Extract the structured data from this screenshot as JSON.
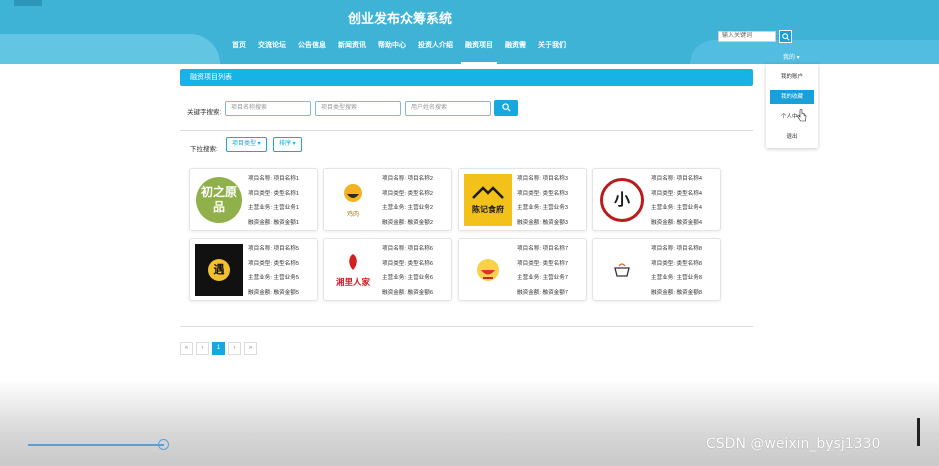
{
  "header": {
    "title": "创业发布众筹系统",
    "nav": [
      "首页",
      "交流论坛",
      "公告信息",
      "新闻资讯",
      "帮助中心",
      "投资人介绍",
      "融资项目",
      "融资需",
      "关于我们"
    ],
    "active_nav_index": 6,
    "search_placeholder": "输入关键词",
    "user_label": "我的 ▾"
  },
  "dropdown": {
    "items": [
      "我的账户",
      "我的收藏",
      "个人中心",
      "退出"
    ],
    "active_index": 1
  },
  "main": {
    "list_title": "融资项目列表",
    "keyword_label": "关键字搜索:",
    "inputs": [
      "项目名称搜索",
      "项目类型搜索",
      "用户姓名搜索"
    ],
    "search_icon": "search-icon",
    "dropdown_label": "下拉搜索:",
    "dropdown_buttons": [
      "项目类型 ▾",
      "排序 ▾"
    ]
  },
  "cards": [
    {
      "name": "项目名称: 项目名称1",
      "type": "项目类型: 类型名称1",
      "biz": "主营业务: 主营业务1",
      "amount": "融资金额: 融资金额1",
      "logo_text": "初之原品"
    },
    {
      "name": "项目名称: 项目名称2",
      "type": "项目类型: 类型名称2",
      "biz": "主营业务: 主营业务2",
      "amount": "融资金额: 融资金额2",
      "logo_text": "鸡肉"
    },
    {
      "name": "项目名称: 项目名称3",
      "type": "项目类型: 类型名称3",
      "biz": "主营业务: 主营业务3",
      "amount": "融资金额: 融资金额3",
      "logo_text": "陈记食府"
    },
    {
      "name": "项目名称: 项目名称4",
      "type": "项目类型: 类型名称4",
      "biz": "主营业务: 主营业务4",
      "amount": "融资金额: 融资金额4",
      "logo_text": "小"
    },
    {
      "name": "项目名称: 项目名称5",
      "type": "项目类型: 类型名称5",
      "biz": "主营业务: 主营业务5",
      "amount": "融资金额: 融资金额5",
      "logo_text": "遇"
    },
    {
      "name": "项目名称: 项目名称6",
      "type": "项目类型: 类型名称6",
      "biz": "主营业务: 主营业务6",
      "amount": "融资金额: 融资金额6",
      "logo_text": "湘里人家"
    },
    {
      "name": "项目名称: 项目名称7",
      "type": "项目类型: 类型名称7",
      "biz": "主营业务: 主营业务7",
      "amount": "融资金额: 融资金额7",
      "logo_text": ""
    },
    {
      "name": "项目名称: 项目名称8",
      "type": "项目类型: 类型名称8",
      "biz": "主营业务: 主营业务8",
      "amount": "融资金额: 融资金额8",
      "logo_text": ""
    }
  ],
  "pagination": [
    "«",
    "‹",
    "1",
    "›",
    "»"
  ],
  "pagination_active_index": 2,
  "watermark": "CSDN @weixin_bysj1330",
  "colors": {
    "header": "#3fb3d6",
    "accent": "#17a8e0"
  }
}
